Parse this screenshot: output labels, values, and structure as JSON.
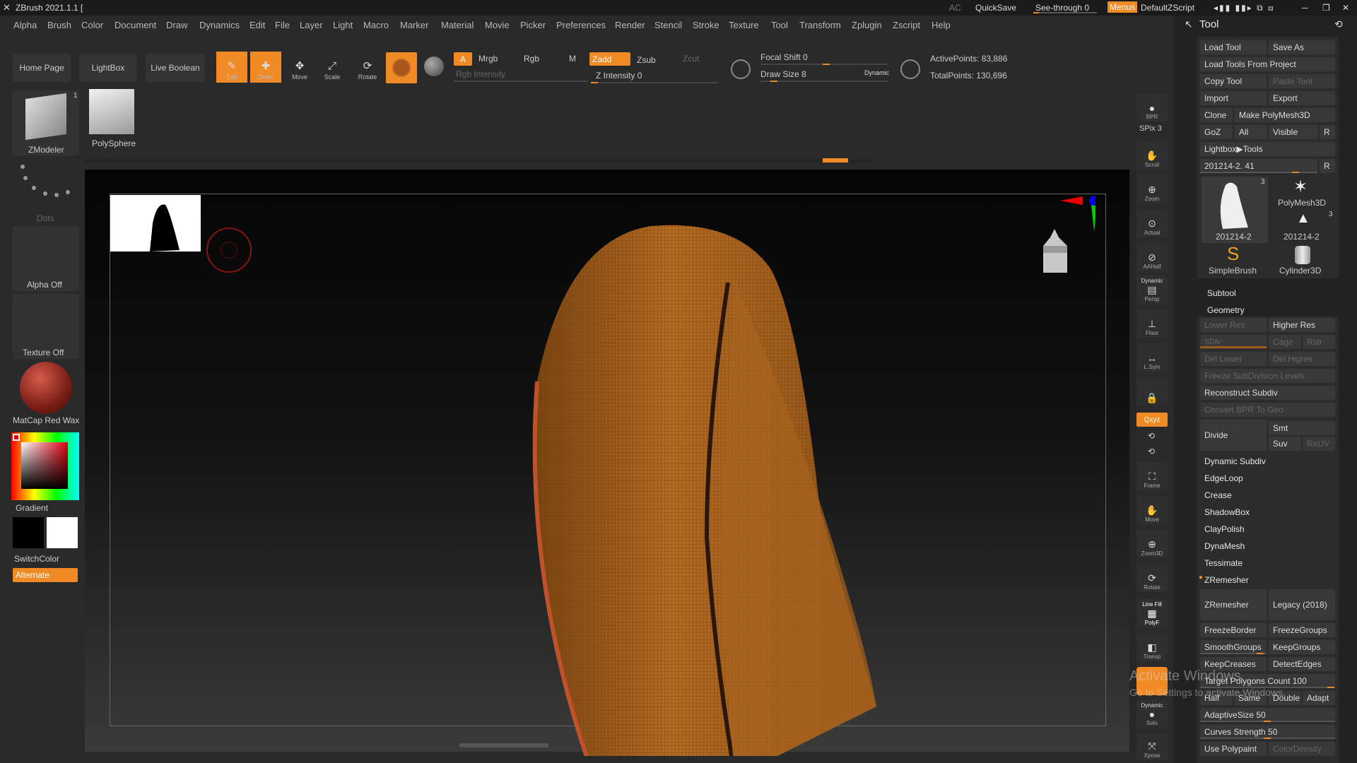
{
  "app": {
    "title": "ZBrush 2021.1.1 [",
    "ac": "AC",
    "quicksave": "QuickSave",
    "see_through": "See-through  0",
    "menus": "Menus",
    "script": "DefaultZScript"
  },
  "menu": [
    "Alpha",
    "Brush",
    "Color",
    "Document",
    "Draw",
    "Dynamics",
    "Edit",
    "File",
    "Layer",
    "Light",
    "Macro",
    "Marker",
    "Material",
    "Movie",
    "Picker",
    "Preferences",
    "Render",
    "Stencil",
    "Stroke",
    "Texture",
    "Tool",
    "Transform",
    "Zplugin",
    "Zscript",
    "Help"
  ],
  "toolbar": {
    "home": "Home Page",
    "lightbox": "LightBox",
    "live_boolean": "Live Boolean",
    "edit": "Edit",
    "draw": "Draw",
    "move": "Move",
    "scale": "Scale",
    "rotate": "Rotate",
    "a": "A",
    "mrgb": "Mrgb",
    "rgb": "Rgb",
    "m": "M",
    "zadd": "Zadd",
    "zsub": "Zsub",
    "zcut": "Zcut",
    "rgb_intensity": "Rgb Intensity",
    "z_intensity": "Z Intensity 0",
    "focal_shift": "Focal Shift 0",
    "draw_size": "Draw Size 8",
    "dynamic": "Dynamic",
    "active_points": "ActivePoints: 83,886",
    "total_points": "TotalPoints: 130,696"
  },
  "left": {
    "zmodeler": "ZModeler",
    "zmodeler_count": "1",
    "polysphere": "PolySphere",
    "dots": "Dots",
    "alpha": "Alpha Off",
    "texture": "Texture Off",
    "material": "MatCap Red Wax",
    "gradient": "Gradient",
    "switchcolor": "SwitchColor",
    "alternate": "Alternate"
  },
  "right_shelf": {
    "bpr": "BPR",
    "spix": "SPix 3",
    "scroll": "Scroll",
    "zoom": "Zoom",
    "actual": "Actual",
    "aahalf": "AAHalf",
    "persp": "Persp",
    "dynamic_label": "Dynamic",
    "floor": "Floor",
    "lsym": "L.Sym",
    "xyz": "Qxyz",
    "frame": "Frame",
    "move": "Move",
    "zoom3d": "Zoom3D",
    "rotate": "Rotate",
    "polyf": "PolyF",
    "linefill": "Line Fill",
    "transp": "Transp",
    "solo": "Solo",
    "dynamic2": "Dynamic",
    "xpose": "Xpose"
  },
  "tool": {
    "title": "Tool",
    "load_tool": "Load Tool",
    "save_as": "Save As",
    "load_from_project": "Load Tools From Project",
    "copy_tool": "Copy Tool",
    "paste_tool": "Paste Tool",
    "import": "Import",
    "export": "Export",
    "clone": "Clone",
    "make_polymesh": "Make PolyMesh3D",
    "goz": "GoZ",
    "all": "All",
    "visible": "Visible",
    "r": "R",
    "lightbox_tools": "Lightbox▶Tools",
    "current": "201214-2. 41",
    "thumbs": [
      {
        "name": "201214-2",
        "count": "3"
      },
      {
        "name": "PolyMesh3D",
        "count": ""
      },
      {
        "name": "201214-2",
        "count": "3"
      },
      {
        "name": "SimpleBrush",
        "count": ""
      },
      {
        "name": "Cylinder3D",
        "count": ""
      }
    ],
    "subtool": "Subtool",
    "geometry": "Geometry",
    "lower_res": "Lower Res",
    "higher_res": "Higher Res",
    "sdiv": "SDiv",
    "cage": "Cage",
    "rstr": "Rstr",
    "del_lower": "Del Lower",
    "del_higher": "Del Higher",
    "freeze_subdiv": "Freeze SubDivision Levels",
    "reconstruct": "Reconstruct Subdiv",
    "convert_bpr": "Convert BPR To Geo",
    "divide": "Divide",
    "smt": "Smt",
    "suv": "Suv",
    "reuv": "ReUV",
    "dynamic_subdiv": "Dynamic Subdiv",
    "edgeloop": "EdgeLoop",
    "crease": "Crease",
    "shadowbox": "ShadowBox",
    "claypolish": "ClayPolish",
    "dynamesh": "DynaMesh",
    "tessimate": "Tessimate",
    "zremesher_head": "ZRemesher",
    "zremesher": "ZRemesher",
    "legacy": "Legacy (2018)",
    "freezeborder": "FreezeBorder",
    "freezegroups": "FreezeGroups",
    "smoothgroups": "SmoothGroups",
    "keepgroups": "KeepGroups",
    "keepcreases": "KeepCreases",
    "detectedges": "DetectEdges",
    "target_count": "Target Polygons Count 100",
    "half": "Half",
    "same": "Same",
    "double": "Double",
    "adapt": "Adapt",
    "adaptive_size": "AdaptiveSize 50",
    "curves_strength": "Curves Strength 50",
    "use_polypaint": "Use Polypaint",
    "color_density": "ColorDensity"
  },
  "watermark": {
    "line1": "Activate Windows",
    "line2": "Go to Settings to activate Windows."
  },
  "colors": {
    "accent": "#f08a24",
    "bg": "#2a2a2a",
    "mesh": "#a8621c"
  }
}
